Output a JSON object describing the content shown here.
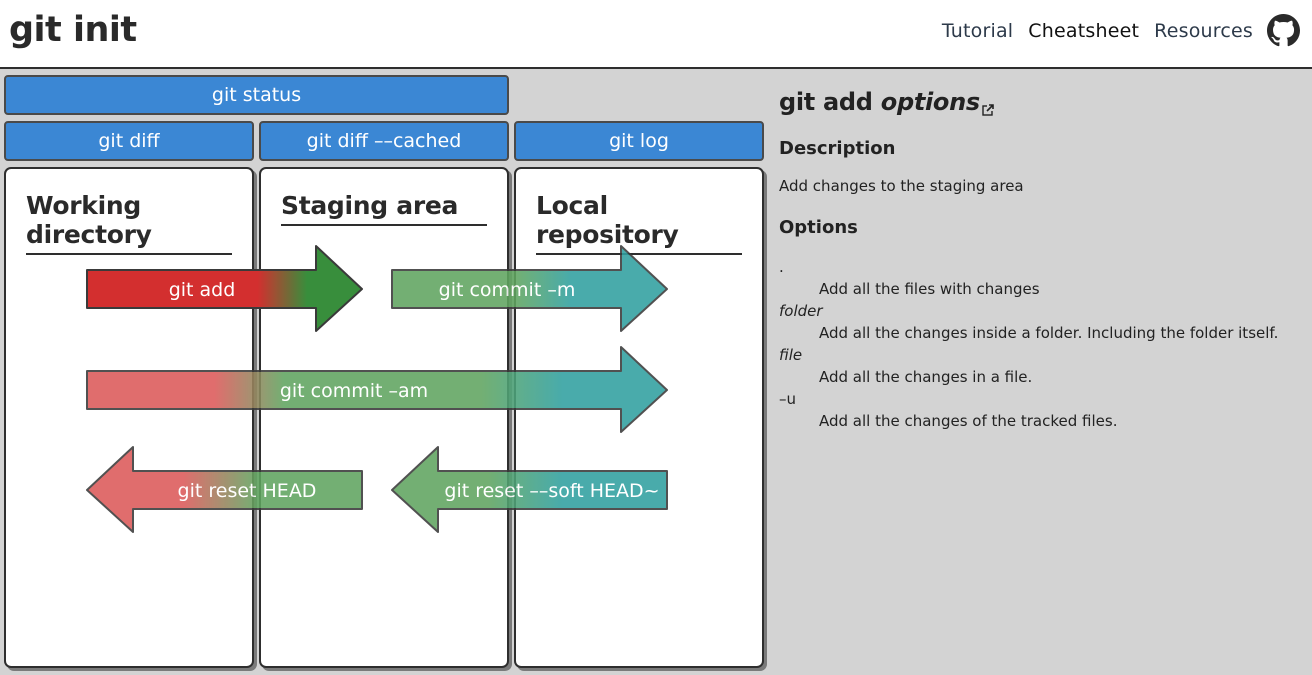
{
  "header": {
    "logo": "git init",
    "nav": [
      {
        "label": "Tutorial",
        "active": false
      },
      {
        "label": "Cheatsheet",
        "active": true
      },
      {
        "label": "Resources",
        "active": false
      }
    ],
    "github_icon": "github-icon"
  },
  "commands": {
    "status": "git status",
    "diff": "git diff",
    "diff_cached": "git diff ––cached",
    "log": "git log"
  },
  "columns": [
    {
      "title": "Working directory"
    },
    {
      "title": "Staging area"
    },
    {
      "title": "Local repository"
    }
  ],
  "arrows": [
    {
      "label": "git add",
      "direction": "right",
      "from": "Working directory",
      "to": "Staging area",
      "active": true
    },
    {
      "label": "git commit –m",
      "direction": "right",
      "from": "Staging area",
      "to": "Local repository",
      "active": false
    },
    {
      "label": "git commit –am",
      "direction": "right",
      "from": "Working directory",
      "to": "Local repository",
      "active": false
    },
    {
      "label": "git reset HEAD",
      "direction": "left",
      "from": "Staging area",
      "to": "Working directory",
      "active": false
    },
    {
      "label": "git reset ––soft HEAD~",
      "direction": "left",
      "from": "Local repository",
      "to": "Staging area",
      "active": false
    }
  ],
  "colors": {
    "command_blue": "#3b87d4",
    "red": "#d32f2f",
    "green": "#388e3c",
    "teal": "#26a0a0"
  },
  "panel": {
    "command": "git add",
    "command_arg": "options",
    "external_link_icon": "external-link-icon",
    "description_heading": "Description",
    "description": "Add changes to the staging area",
    "options_heading": "Options",
    "options": [
      {
        "term": ".",
        "italic": false,
        "desc": "Add all the files with changes"
      },
      {
        "term": "folder",
        "italic": true,
        "desc": "Add all the changes inside a folder. Including the folder itself."
      },
      {
        "term": "file",
        "italic": true,
        "desc": "Add all the changes in a file."
      },
      {
        "term": "–u",
        "italic": false,
        "desc": "Add all the changes of the tracked files."
      }
    ]
  }
}
